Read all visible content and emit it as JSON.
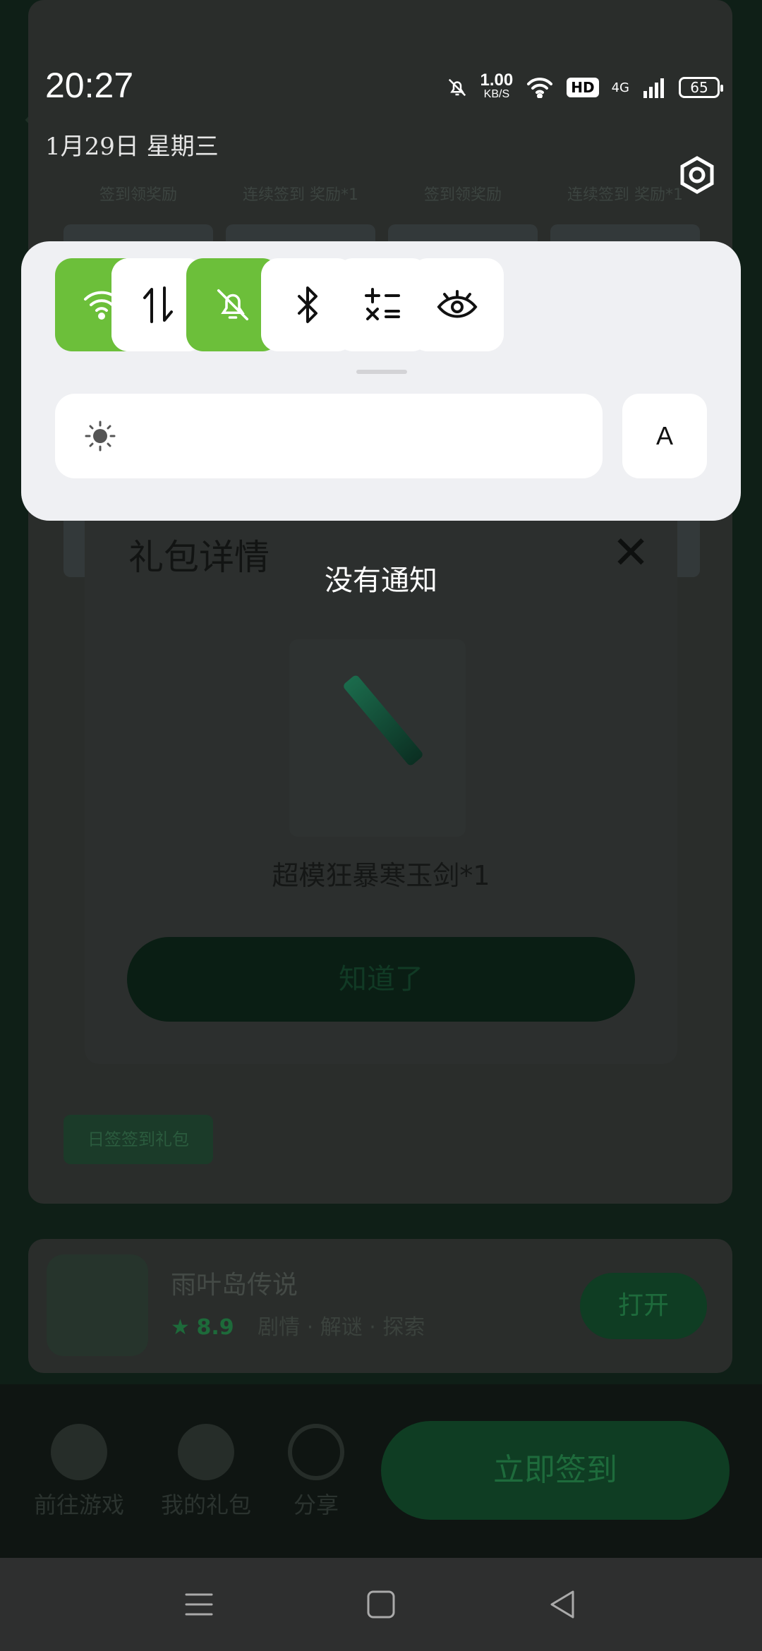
{
  "status_bar": {
    "time": "20:27",
    "date": "1月29日 星期三",
    "net_speed_value": "1.00",
    "net_speed_unit": "KB/S",
    "hd_label": "HD",
    "network_type": "4G",
    "battery": "65"
  },
  "quick_settings": {
    "tiles": [
      {
        "name": "wifi",
        "icon": "wifi-icon",
        "active": true
      },
      {
        "name": "mobile-data",
        "icon": "data-transfer-icon",
        "active": false
      },
      {
        "name": "do-not-disturb",
        "icon": "bell-off-icon",
        "active": true
      },
      {
        "name": "bluetooth",
        "icon": "bluetooth-icon",
        "active": false
      },
      {
        "name": "calculator",
        "icon": "calculator-icon",
        "active": false
      },
      {
        "name": "eye-comfort",
        "icon": "eye-icon",
        "active": false
      }
    ],
    "auto_brightness_label": "A",
    "accent_color": "#6cbf3a"
  },
  "notifications": {
    "empty_text": "没有通知"
  },
  "background_app": {
    "gift_dialog": {
      "title": "礼包详情",
      "close_glyph": "✕",
      "item_name": "超模狂暴寒玉剑*1",
      "confirm_label": "知道了"
    },
    "tile_labels": [
      "签到领奖励",
      "连续签到  奖励*1",
      "签到领奖励",
      "连续签到  奖励*1"
    ],
    "daily_gift_button": "日签签到礼包",
    "game": {
      "title": "雨叶岛传说",
      "rating": "8.9",
      "tags": "剧情 · 解谜 · 探索",
      "open_button": "打开"
    },
    "bottom_bar": {
      "go_game": "前往游戏",
      "my_gifts": "我的礼包",
      "share": "分享",
      "sign_in": "立即签到"
    }
  }
}
